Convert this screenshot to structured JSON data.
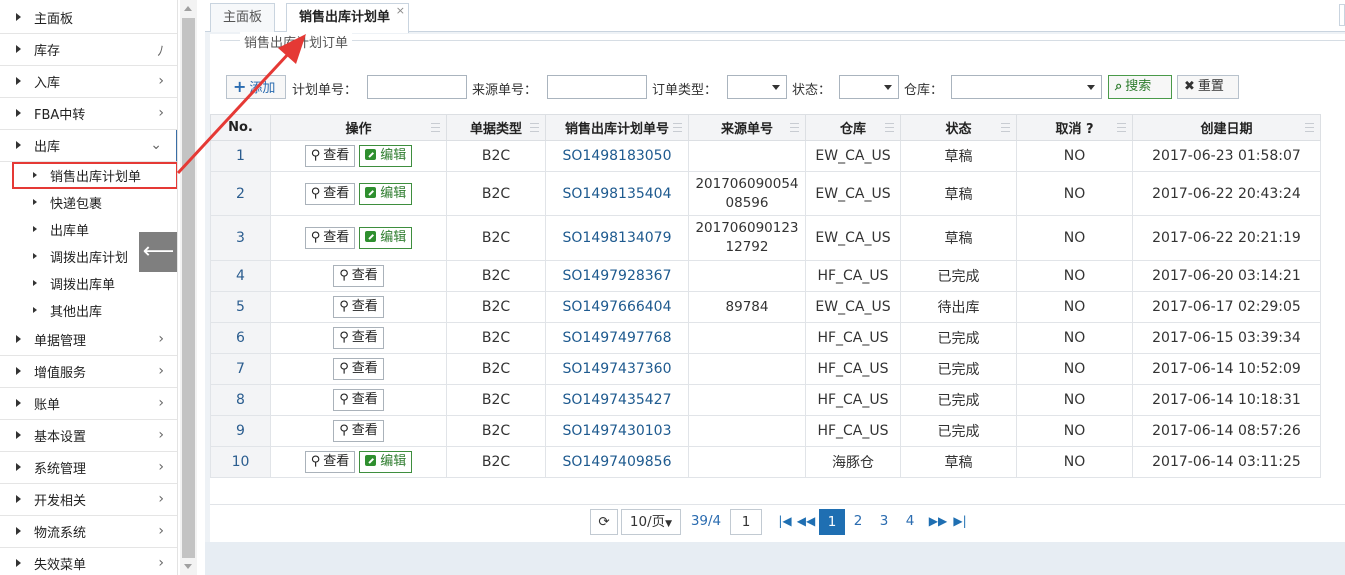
{
  "sidebar": {
    "items": [
      {
        "label": "主面板",
        "chev": ""
      },
      {
        "label": "库存",
        "chev": "ﾉ"
      },
      {
        "label": "入库",
        "chev": "›"
      },
      {
        "label": "FBA中转",
        "chev": "›"
      },
      {
        "label": "出库",
        "chev": "⌄"
      },
      {
        "label": "单据管理",
        "chev": "›"
      },
      {
        "label": "增值服务",
        "chev": "›"
      },
      {
        "label": "账单",
        "chev": "›"
      },
      {
        "label": "基本设置",
        "chev": "›"
      },
      {
        "label": "系统管理",
        "chev": "›"
      },
      {
        "label": "开发相关",
        "chev": "›"
      },
      {
        "label": "物流系统",
        "chev": "›"
      },
      {
        "label": "失效菜单",
        "chev": "›"
      }
    ],
    "sub_items": [
      {
        "label": "销售出库计划单"
      },
      {
        "label": "快递包裹"
      },
      {
        "label": "出库单"
      },
      {
        "label": "调拨出库计划"
      },
      {
        "label": "调拨出库单"
      },
      {
        "label": "其他出库"
      }
    ],
    "collapse_glyph": "⟵"
  },
  "tabs": [
    {
      "label": "主面板"
    },
    {
      "label": "销售出库计划单",
      "close": "×"
    }
  ],
  "filters": {
    "legend": "销售出库计划订单",
    "add_label": "添加",
    "plan_no_label": "计划单号：",
    "source_no_label": "来源单号：",
    "order_type_label": "订单类型：",
    "status_label": "状态：",
    "warehouse_label": "仓库：",
    "search_label": "搜索",
    "reset_label": "重置",
    "plan_no_value": "",
    "source_no_value": "",
    "order_type_value": "",
    "status_value": "",
    "warehouse_value": ""
  },
  "grid": {
    "headers": [
      "No.",
      "操作",
      "单据类型",
      "销售出库计划单号",
      "来源单号",
      "仓库",
      "状态",
      "取消 ?",
      "创建日期"
    ],
    "view_label": "查看",
    "edit_label": "编辑",
    "rows": [
      {
        "no": "1",
        "edit": true,
        "type": "B2C",
        "plan": "SO1498183050",
        "src1": "",
        "src2": "",
        "wh": "EW_CA_US",
        "status": "草稿",
        "cancel": "NO",
        "date": "2017-06-23 01:58:07"
      },
      {
        "no": "2",
        "edit": true,
        "type": "B2C",
        "plan": "SO1498135404",
        "src1": "201706090054",
        "src2": "08596",
        "wh": "EW_CA_US",
        "status": "草稿",
        "cancel": "NO",
        "date": "2017-06-22 20:43:24"
      },
      {
        "no": "3",
        "edit": true,
        "type": "B2C",
        "plan": "SO1498134079",
        "src1": "201706090123",
        "src2": "12792",
        "wh": "EW_CA_US",
        "status": "草稿",
        "cancel": "NO",
        "date": "2017-06-22 20:21:19"
      },
      {
        "no": "4",
        "edit": false,
        "type": "B2C",
        "plan": "SO1497928367",
        "src1": "",
        "src2": "",
        "wh": "HF_CA_US",
        "status": "已完成",
        "cancel": "NO",
        "date": "2017-06-20 03:14:21"
      },
      {
        "no": "5",
        "edit": false,
        "type": "B2C",
        "plan": "SO1497666404",
        "src1": "89784",
        "src2": "",
        "wh": "EW_CA_US",
        "status": "待出库",
        "cancel": "NO",
        "date": "2017-06-17 02:29:05"
      },
      {
        "no": "6",
        "edit": false,
        "type": "B2C",
        "plan": "SO1497497768",
        "src1": "",
        "src2": "",
        "wh": "HF_CA_US",
        "status": "已完成",
        "cancel": "NO",
        "date": "2017-06-15 03:39:34"
      },
      {
        "no": "7",
        "edit": false,
        "type": "B2C",
        "plan": "SO1497437360",
        "src1": "",
        "src2": "",
        "wh": "HF_CA_US",
        "status": "已完成",
        "cancel": "NO",
        "date": "2017-06-14 10:52:09"
      },
      {
        "no": "8",
        "edit": false,
        "type": "B2C",
        "plan": "SO1497435427",
        "src1": "",
        "src2": "",
        "wh": "HF_CA_US",
        "status": "已完成",
        "cancel": "NO",
        "date": "2017-06-14 10:18:31"
      },
      {
        "no": "9",
        "edit": false,
        "type": "B2C",
        "plan": "SO1497430103",
        "src1": "",
        "src2": "",
        "wh": "HF_CA_US",
        "status": "已完成",
        "cancel": "NO",
        "date": "2017-06-14 08:57:26"
      },
      {
        "no": "10",
        "edit": true,
        "type": "B2C",
        "plan": "SO1497409856",
        "src1": "",
        "src2": "",
        "wh": "海豚仓",
        "status": "草稿",
        "cancel": "NO",
        "date": "2017-06-14 03:11:25"
      }
    ]
  },
  "pager": {
    "refresh_glyph": "⟳",
    "page_size": "10/页",
    "page_info": "39/4",
    "page_input": "1",
    "first_glyph": "|◀",
    "prev_glyph": "◀◀",
    "pages": [
      "1",
      "2",
      "3",
      "4"
    ],
    "next_glyph": "▶▶",
    "last_glyph": "▶|"
  },
  "colors": {
    "accent": "#1f6fb2",
    "annotation": "#e53935",
    "edit_green": "#2f7d2f"
  }
}
